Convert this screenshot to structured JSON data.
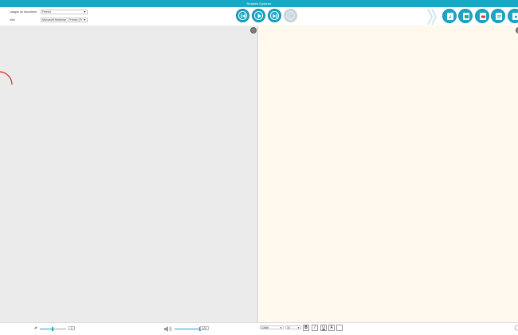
{
  "app": {
    "title": "Readiris Dyslexie"
  },
  "toolbar": {
    "document_language_label": "Langue du document",
    "document_language_value": "French",
    "voice_label": "Voix",
    "voice_value": "Microsoft Hortense - French (Fr"
  },
  "statusbar": {
    "speed_value": "0",
    "volume_value": "100",
    "font_value": "Calibri",
    "font_size_value": "16",
    "bold_label": "B",
    "italic_label": "I",
    "underline_label": "U",
    "text_color_label": "A"
  },
  "colors": {
    "accent": "#19a6c7",
    "left_pane": "#ebebeb",
    "right_pane": "#fef9ec",
    "spinner": "#e02424"
  }
}
